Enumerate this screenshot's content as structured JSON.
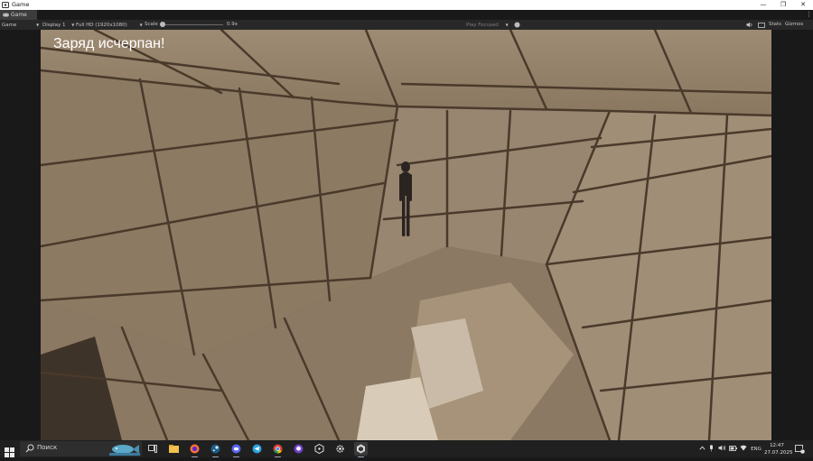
{
  "window": {
    "title": "Game",
    "min_symbol": "—",
    "max_symbol": "❐",
    "close_symbol": "✕"
  },
  "tabbar": {
    "tab_label": "Game",
    "tab_icon": "gamepad-icon",
    "more_symbol": "⋮"
  },
  "toolbar": {
    "view_mode": "Game",
    "display": "Display 1",
    "resolution": "Full HD (1920x1080)",
    "scale_label": "Scale",
    "scale_value": "0.9x",
    "play_focused": "Play Focused",
    "stats": "Stats",
    "gizmos": "Gizmos",
    "caret": "▼",
    "scale_fraction": 0
  },
  "game": {
    "message": "Заряд исчерпан!"
  },
  "taskbar": {
    "search_placeholder": "Поиск",
    "language": "ENG",
    "time": "12:47",
    "date": "27.07.2025",
    "notification_count": "1",
    "apps": [
      "task-view-icon",
      "file-explorer-icon",
      "firefox-icon",
      "steam-icon",
      "discord-icon",
      "telegram-icon",
      "chrome-icon",
      "github-desktop-icon",
      "unity-hub-icon",
      "settings-icon",
      "unity-editor-icon"
    ]
  },
  "colors": {
    "accent": "#4c9be8",
    "editor_bg": "#191919",
    "toolbar_bg": "#282828",
    "tab_bg": "#3c3c3c"
  }
}
